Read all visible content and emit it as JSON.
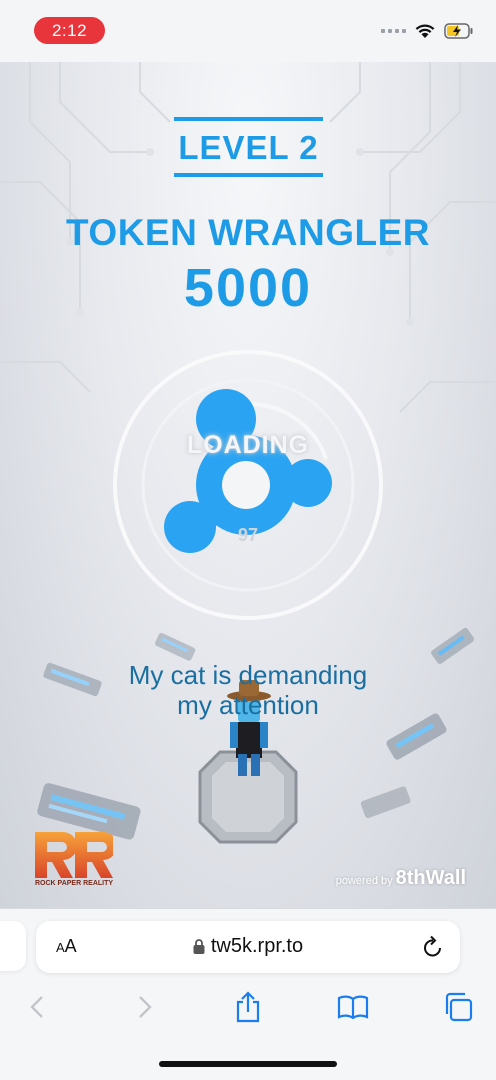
{
  "status_bar": {
    "time": "2:12",
    "icons": [
      "signal-dots-icon",
      "wifi-icon",
      "battery-charging-icon"
    ]
  },
  "game": {
    "level": "LEVEL 2",
    "title": "TOKEN WRANGLER",
    "score": "5000",
    "loading_label": "LOADING",
    "loading_progress": "97",
    "message_line1": "My cat is demanding",
    "message_line2": "my attention",
    "logo_text": "ROCK PAPER REALITY",
    "powered_prefix": "powered by",
    "powered_brand": "8thWall"
  },
  "browser": {
    "text_size_label_small": "A",
    "text_size_label_large": "A",
    "url": "tw5k.rpr.to",
    "toolbar": [
      "back-icon",
      "forward-icon",
      "share-icon",
      "bookmarks-icon",
      "tabs-icon"
    ]
  },
  "colors": {
    "accent": "#1e9be6",
    "message": "#1a6fa0",
    "time_pill": "#e8343b"
  }
}
